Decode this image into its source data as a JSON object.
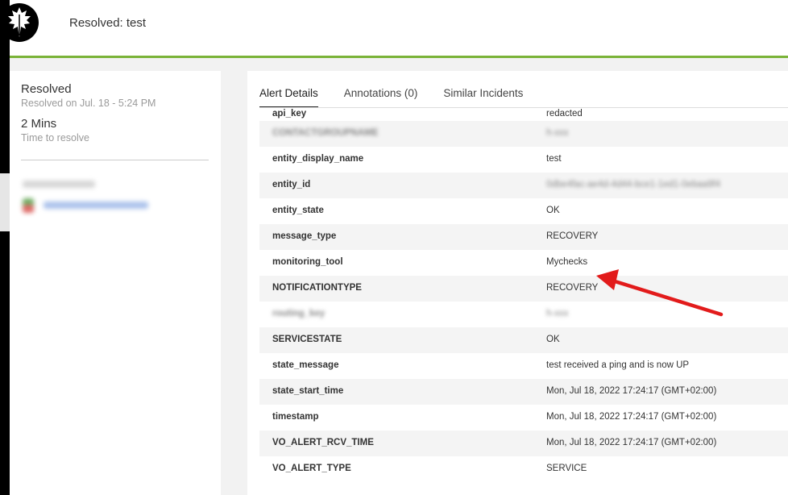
{
  "header": {
    "title": "Resolved: test",
    "logo_icon": "leaf-icon"
  },
  "summary": {
    "status": "Resolved",
    "resolved_on": "Resolved on Jul. 18 - 5:24 PM",
    "duration": "2 Mins",
    "duration_label": "Time to resolve"
  },
  "tabs": [
    {
      "label": "Alert Details",
      "active": true
    },
    {
      "label": "Annotations (0)",
      "active": false
    },
    {
      "label": "Similar Incidents",
      "active": false
    }
  ],
  "details": [
    {
      "key": "api_key",
      "value": "redacted"
    },
    {
      "key": "CONTACTGROUPNAME",
      "value": "h-xxx"
    },
    {
      "key": "entity_display_name",
      "value": "test"
    },
    {
      "key": "entity_id",
      "value": "0dbe4fac-ae4d-4d44-bce1-1ed1-0ebaa9f4"
    },
    {
      "key": "entity_state",
      "value": "OK"
    },
    {
      "key": "message_type",
      "value": "RECOVERY"
    },
    {
      "key": "monitoring_tool",
      "value": "Mychecks"
    },
    {
      "key": "NOTIFICATIONTYPE",
      "value": "RECOVERY"
    },
    {
      "key": "routing_key",
      "value": "h-xxx"
    },
    {
      "key": "SERVICESTATE",
      "value": "OK"
    },
    {
      "key": "state_message",
      "value": "test received a ping and is now UP"
    },
    {
      "key": "state_start_time",
      "value": "Mon, Jul 18, 2022 17:24:17 (GMT+02:00)"
    },
    {
      "key": "timestamp",
      "value": "Mon, Jul 18, 2022 17:24:17 (GMT+02:00)"
    },
    {
      "key": "VO_ALERT_RCV_TIME",
      "value": "Mon, Jul 18, 2022 17:24:17 (GMT+02:00)"
    },
    {
      "key": "VO_ALERT_TYPE",
      "value": "SERVICE"
    }
  ],
  "colors": {
    "accent": "#7ab338",
    "arrow": "#e21b1b"
  }
}
